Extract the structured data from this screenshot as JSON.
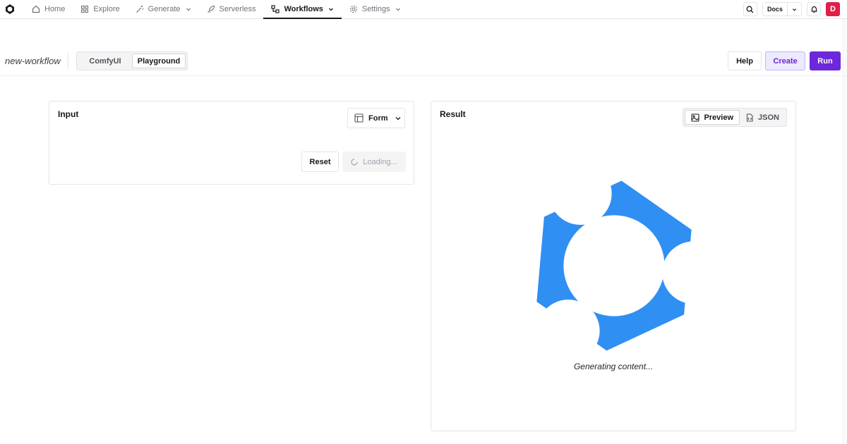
{
  "nav": {
    "items": [
      {
        "label": "Home",
        "icon": "home-icon",
        "has_menu": false
      },
      {
        "label": "Explore",
        "icon": "grid-icon",
        "has_menu": false
      },
      {
        "label": "Generate",
        "icon": "magic-wand-icon",
        "has_menu": true
      },
      {
        "label": "Serverless",
        "icon": "rocket-icon",
        "has_menu": false
      },
      {
        "label": "Workflows",
        "icon": "workflow-icon",
        "has_menu": true,
        "active": true
      },
      {
        "label": "Settings",
        "icon": "gear-icon",
        "has_menu": true
      }
    ],
    "docs_label": "Docs",
    "avatar_initial": "D",
    "avatar_color": "#e11d48"
  },
  "workflow": {
    "name": "new-workflow",
    "modes": [
      {
        "label": "ComfyUI",
        "active": false
      },
      {
        "label": "Playground",
        "active": true
      }
    ],
    "help_label": "Help",
    "create_label": "Create",
    "run_label": "Run",
    "accent_color": "#6d28d9"
  },
  "input_panel": {
    "title": "Input",
    "view_select": "Form",
    "reset_label": "Reset",
    "loading_label": "Loading..."
  },
  "result_panel": {
    "title": "Result",
    "views": [
      {
        "label": "Preview",
        "icon": "image-icon",
        "active": true
      },
      {
        "label": "JSON",
        "icon": "file-code-icon",
        "active": false
      }
    ],
    "status_text": "Generating content...",
    "spinner_color": "#2f8ff3"
  }
}
